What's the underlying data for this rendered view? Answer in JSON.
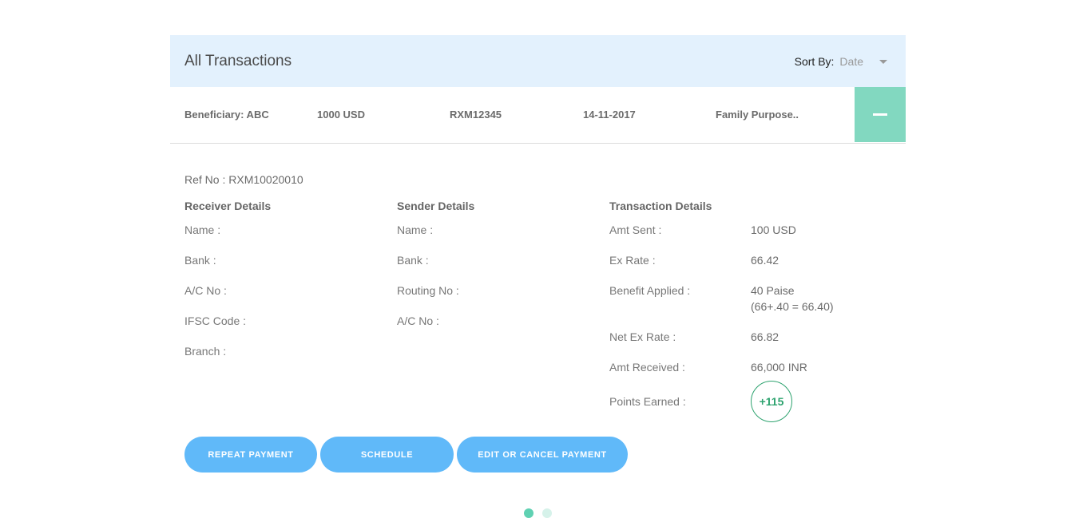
{
  "header": {
    "title": "All Transactions",
    "sort_label": "Sort By:",
    "sort_value": "Date"
  },
  "summary": {
    "beneficiary": "Beneficiary: ABC",
    "amount": "1000 USD",
    "ref": "RXM12345",
    "date": "14-11-2017",
    "purpose": "Family Purpose.."
  },
  "details": {
    "ref_no": "Ref No : RXM10020010",
    "receiver": {
      "heading": "Receiver Details",
      "fields": [
        "Name :",
        "Bank :",
        "A/C No :",
        "IFSC Code :",
        "Branch :"
      ]
    },
    "sender": {
      "heading": "Sender Details",
      "fields": [
        "Name :",
        "Bank :",
        "Routing No :",
        "A/C No :"
      ]
    },
    "transaction": {
      "heading": "Transaction Details",
      "amt_sent_label": "Amt Sent :",
      "amt_sent": "100 USD",
      "ex_rate_label": "Ex Rate :",
      "ex_rate": "66.42",
      "benefit_label": "Benefit Applied :",
      "benefit_line1": "40 Paise",
      "benefit_line2": "(66+.40 = 66.40)",
      "net_rate_label": "Net Ex Rate :",
      "net_rate": "66.82",
      "amt_received_label": "Amt Received :",
      "amt_received": "66,000 INR",
      "points_label": "Points Earned :",
      "points": "+115"
    }
  },
  "actions": {
    "repeat": "REPEAT PAYMENT",
    "schedule": "SCHEDULE",
    "edit_cancel": "EDIT OR CANCEL PAYMENT"
  },
  "colors": {
    "accent": "#82d8c0",
    "button": "#60b9f9",
    "header_bg": "#e3f1fd",
    "points": "#2ea36f"
  }
}
